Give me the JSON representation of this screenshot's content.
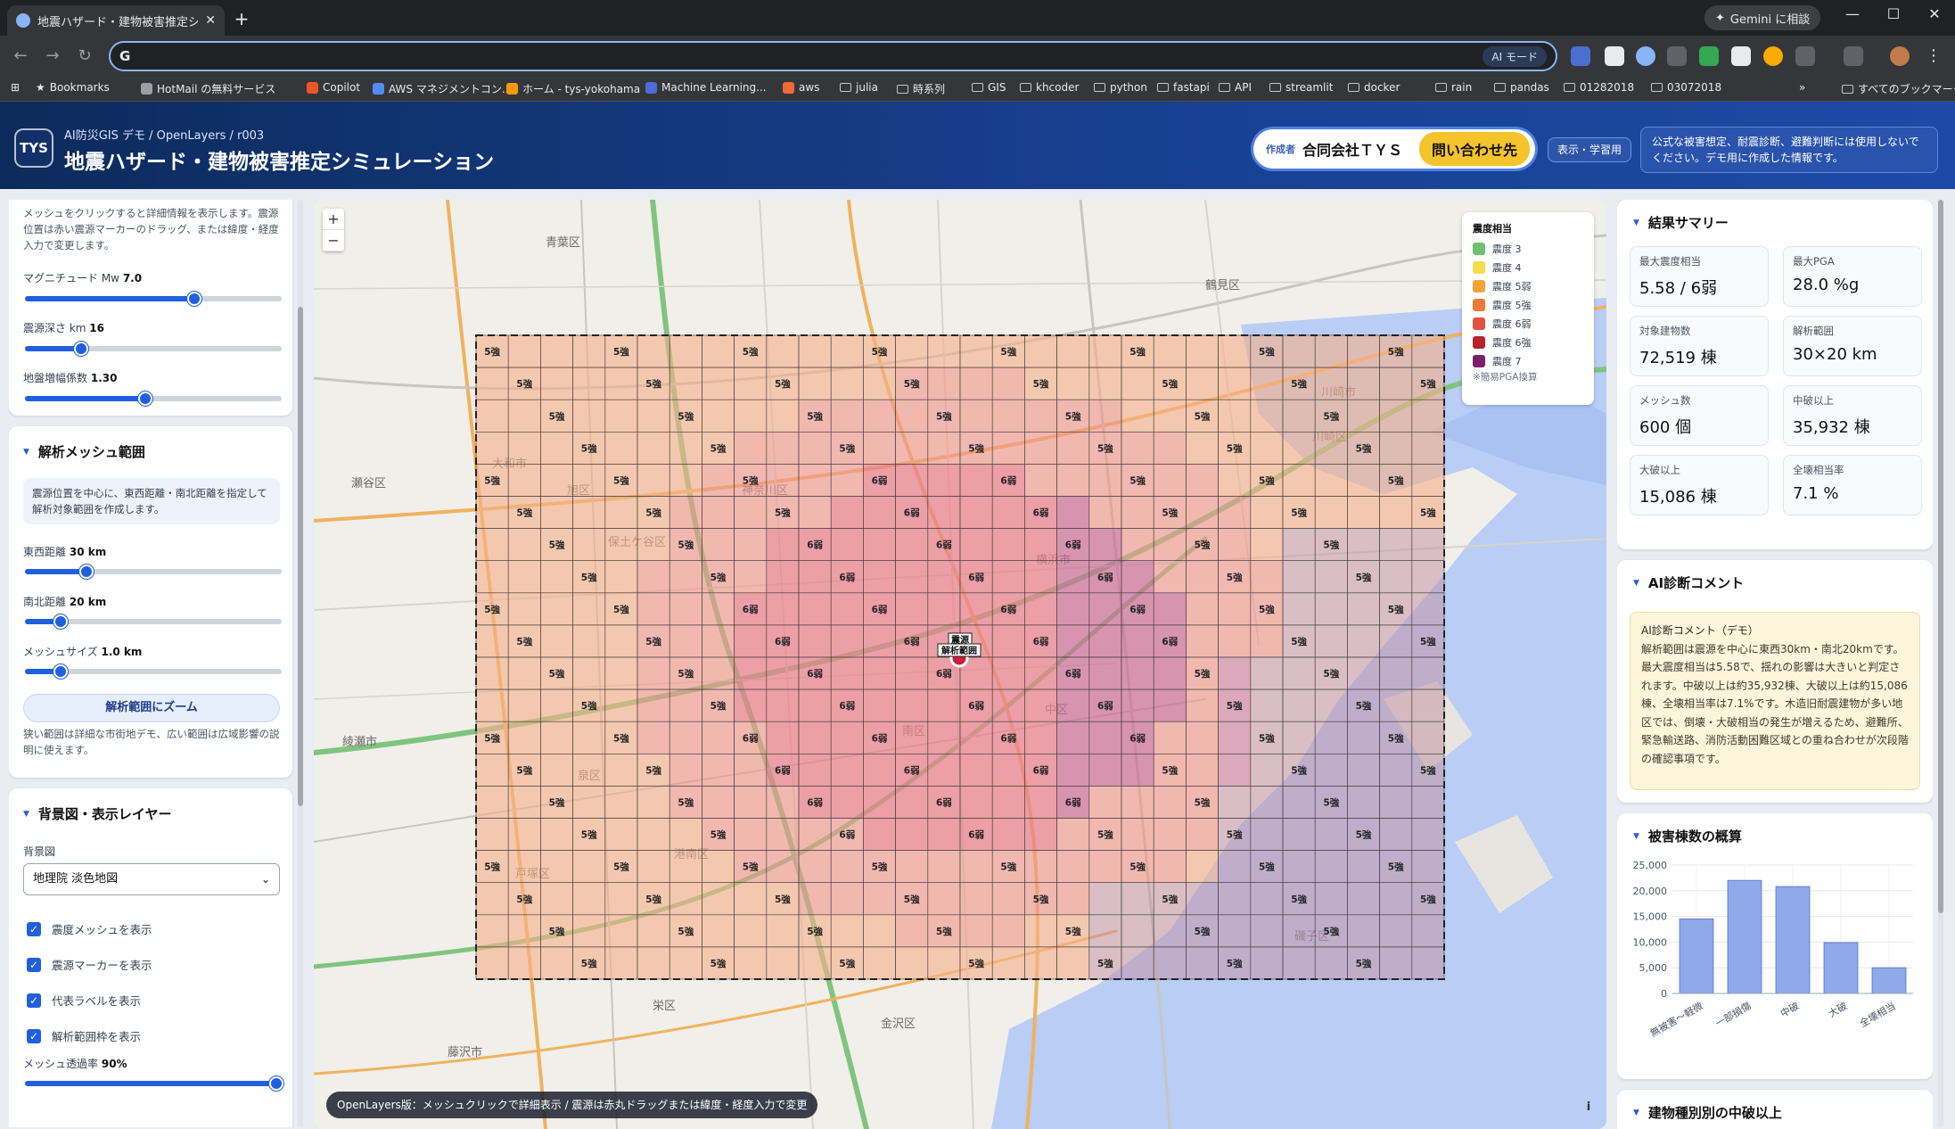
{
  "browser": {
    "tab_title": "地震ハザード・建物被害推定シミュレ",
    "gemini_label": "Gemini に相談",
    "ai_mode": "AI モード",
    "address": "",
    "bookmarks": [
      "Bookmarks",
      "HotMail の無料サービス",
      "Copilot",
      "AWS マネジメントコン...",
      "ホーム - tys-yokohama",
      "Machine Learning...",
      "aws",
      "julia",
      "時系列",
      "GIS",
      "khcoder",
      "python",
      "fastapi",
      "API",
      "streamlit",
      "docker",
      "rain",
      "pandas",
      "01282018",
      "03072018",
      "すべてのブックマーク"
    ]
  },
  "header": {
    "logo": "TYS",
    "breadcrumb": "AI防災GIS デモ / OpenLayers / r003",
    "title": "地震ハザード・建物被害推定シミュレーション",
    "author_label": "作成者",
    "author_name": "合同会社ＴＹＳ",
    "contact_button": "問い合わせ先",
    "learn_button": "表示・学習用",
    "notice": "公式な被害想定、耐震診断、避難判断には使用しないでください。デモ用に作成した情報です。"
  },
  "left": {
    "intro": "メッシュをクリックすると詳細情報を表示します。震源位置は赤い震源マーカーのドラッグ、または緯度・経度入力で変更します。",
    "sliders_top": [
      {
        "label": "マグニチュード Mw",
        "value": "7.0",
        "fraction": 0.66
      },
      {
        "label": "震源深さ km",
        "value": "16",
        "fraction": 0.22
      },
      {
        "label": "地盤増幅係数",
        "value": "1.30",
        "fraction": 0.47
      }
    ],
    "mesh_section": {
      "title": "解析メッシュ範囲",
      "info": "震源位置を中心に、東西距離・南北距離を指定して解析対象範囲を作成します。",
      "sliders": [
        {
          "label": "東西距離",
          "value": "30 km",
          "fraction": 0.24
        },
        {
          "label": "南北距離",
          "value": "20 km",
          "fraction": 0.14
        },
        {
          "label": "メッシュサイズ",
          "value": "1.0 km",
          "fraction": 0.14
        }
      ],
      "zoom_button": "解析範囲にズーム",
      "zoom_note": "狭い範囲は詳細な市街地デモ、広い範囲は広域影響の説明に使えます。"
    },
    "layer_section": {
      "title": "背景図・表示レイヤー",
      "basemap_label": "背景図",
      "basemap_value": "地理院 淡色地図",
      "checks": [
        "震度メッシュを表示",
        "震源マーカーを表示",
        "代表ラベルを表示",
        "解析範囲枠を表示"
      ],
      "opacity_label": "メッシュ透過率",
      "opacity_value": "90%",
      "opacity_fraction": 0.98
    }
  },
  "map": {
    "legend_title": "震度相当",
    "legend": [
      {
        "label": "震度 3",
        "color": "#6cc26f"
      },
      {
        "label": "震度 4",
        "color": "#f6dd4a"
      },
      {
        "label": "震度 5弱",
        "color": "#f5a23c"
      },
      {
        "label": "震度 5強",
        "color": "#ef7a37"
      },
      {
        "label": "震度 6弱",
        "color": "#e2533f"
      },
      {
        "label": "震度 6強",
        "color": "#b8232e"
      },
      {
        "label": "震度 7",
        "color": "#7b1f6b"
      }
    ],
    "legend_note": "※簡易PGA換算",
    "epicenter_label": "震源",
    "range_label": "解析範囲",
    "banner": "OpenLayers版：メッシュクリックで詳細表示 / 震源は赤丸ドラッグまたは緯度・経度入力で変更",
    "zoom_in": "+",
    "zoom_out": "−",
    "info": "i",
    "cell_labels": {
      "weak5": "5強",
      "weak6": "6弱"
    },
    "place_names": [
      "青葉区",
      "瀬谷区",
      "旭区",
      "保土ケ谷区",
      "神奈川区",
      "横浜市",
      "中区",
      "南区",
      "港南区",
      "栄区",
      "泉区",
      "戸塚区",
      "金沢区",
      "綾瀬市",
      "藤沢市",
      "川崎市",
      "川崎区",
      "大和市",
      "鶴見区",
      "磯子区"
    ]
  },
  "right": {
    "summary_title": "結果サマリー",
    "metrics": [
      {
        "label": "最大震度相当",
        "value": "5.58 / 6弱"
      },
      {
        "label": "最大PGA",
        "value": "28.0 %g"
      },
      {
        "label": "対象建物数",
        "value": "72,519 棟"
      },
      {
        "label": "解析範囲",
        "value": "30×20 km"
      },
      {
        "label": "メッシュ数",
        "value": "600 個"
      },
      {
        "label": "中破以上",
        "value": "35,932 棟"
      },
      {
        "label": "大破以上",
        "value": "15,086 棟"
      },
      {
        "label": "全壊相当率",
        "value": "7.1 %"
      }
    ],
    "ai_title": "AI診断コメント",
    "ai_subtitle": "AI診断コメント（デモ）",
    "ai_text": "解析範囲は震源を中心に東西30km・南北20kmです。最大震度相当は5.58で、揺れの影響は大きいと判定されます。中破以上は約35,932棟、大破以上は約15,086棟、全壊相当率は7.1%です。木造旧耐震建物が多い地区では、倒壊・大破相当の発生が増えるため、避難所、緊急輸送路、消防活動困難区域との重ね合わせが次段階の確認事項です。",
    "chart_title": "被害棟数の概算",
    "bottom_title": "建物種別別の中破以上"
  },
  "chart_data": {
    "type": "bar",
    "categories": [
      "無被害〜軽微",
      "一部損傷",
      "中破",
      "大破",
      "全壊相当"
    ],
    "values": [
      14500,
      22000,
      20800,
      9900,
      5000
    ],
    "ylim": [
      0,
      25000
    ],
    "yticks": [
      "0",
      "5,000",
      "10,000",
      "15,000",
      "20,000",
      "25,000"
    ],
    "grid": true,
    "bar_color": "#8fa9ea"
  }
}
